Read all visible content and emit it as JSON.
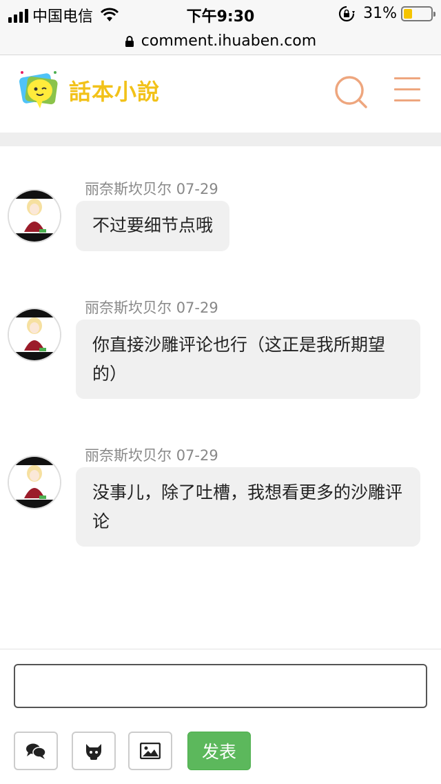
{
  "status_bar": {
    "carrier": "中国电信",
    "time": "下午9:30",
    "battery_percent": "31%",
    "battery_level": 0.31,
    "battery_color": "#f5c400"
  },
  "url_bar": {
    "url": "comment.ihuaben.com"
  },
  "header": {
    "logo_text": "話本小說",
    "icons": [
      "search-icon",
      "menu-icon"
    ],
    "accent_color": "#eea67e"
  },
  "comments": [
    {
      "author": "丽奈斯坎贝尔",
      "date": "07-29",
      "text": "不过要细节点哦"
    },
    {
      "author": "丽奈斯坎贝尔",
      "date": "07-29",
      "text": "你直接沙雕评论也行（这正是我所期望的）"
    },
    {
      "author": "丽奈斯坎贝尔",
      "date": "07-29",
      "text": "没事儿，除了吐槽，我想看更多的沙雕评论"
    }
  ],
  "composer": {
    "input_value": "",
    "tool_icons": [
      "comment-bubbles-icon",
      "github-icon",
      "image-icon"
    ],
    "submit_label": "发表",
    "submit_color": "#5cb85c"
  }
}
